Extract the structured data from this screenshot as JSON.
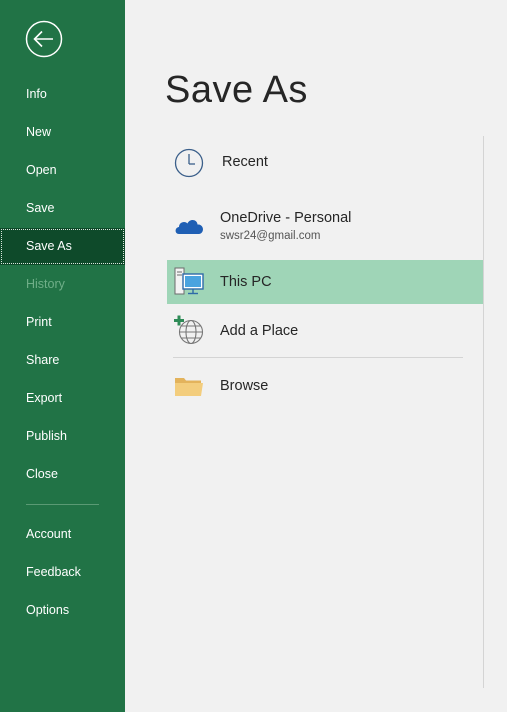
{
  "sidebar": {
    "back_icon": "back-arrow-icon",
    "items": [
      {
        "label": "Info"
      },
      {
        "label": "New"
      },
      {
        "label": "Open"
      },
      {
        "label": "Save"
      },
      {
        "label": "Save As",
        "active": true
      },
      {
        "label": "History",
        "disabled": true
      },
      {
        "label": "Print"
      },
      {
        "label": "Share"
      },
      {
        "label": "Export"
      },
      {
        "label": "Publish"
      },
      {
        "label": "Close"
      },
      {
        "label": "Account"
      },
      {
        "label": "Feedback"
      },
      {
        "label": "Options"
      }
    ]
  },
  "main": {
    "title": "Save As",
    "locations": [
      {
        "label": "Recent",
        "icon": "clock-icon"
      },
      {
        "label": "OneDrive - Personal",
        "sublabel": "swsr24@gmail.com",
        "icon": "onedrive-cloud-icon"
      },
      {
        "label": "This PC",
        "icon": "computer-icon",
        "selected": true
      },
      {
        "label": "Add a Place",
        "icon": "add-place-globe-icon"
      },
      {
        "label": "Browse",
        "icon": "folder-icon"
      }
    ]
  },
  "colors": {
    "sidebar_bg": "#217346",
    "sidebar_active": "#0e4a2a",
    "selected_location": "#9fd5b7",
    "panel_bg": "#f1f1f1"
  }
}
